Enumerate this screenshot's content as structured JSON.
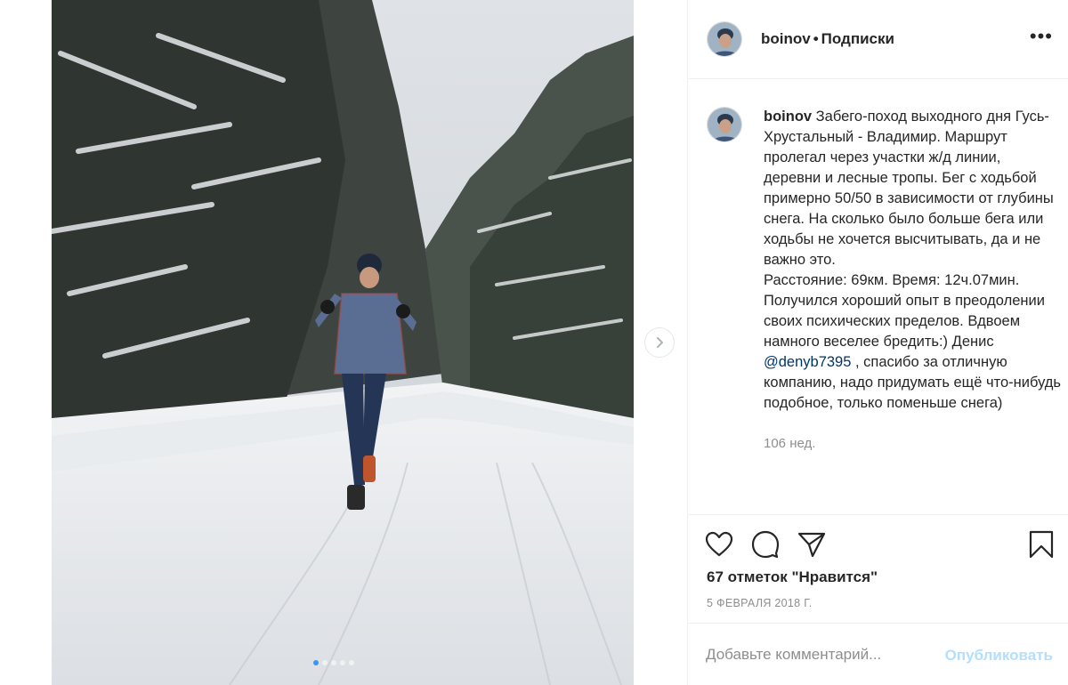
{
  "post": {
    "username": "boinov",
    "follow_status": "Подписки",
    "more_icon": "more-horizontal-icon",
    "photo_alt": "Бегун в клетчатой куртке на заснеженной лесной дороге",
    "carousel": {
      "total_slides": 5,
      "active_slide": 1
    }
  },
  "caption": {
    "username": "boinov",
    "text_part1": "Забего-поход выходного дня Гусь-Хрустальный - Владимир. Маршрут пролегал через участки ж/д линии, деревни и лесные тропы. Бег с ходьбой примерно 50/50 в зависимости от глубины снега. На сколько было больше бега или ходьбы не хочется высчитывать, да и не важно это.",
    "text_part2": "Расстояние: 69км. Время: 12ч.07мин.",
    "text_part3": "Получился хороший опыт в преодолении своих психических пределов. Вдвоем намного веселее бредить:) Денис ",
    "mention": "@denyb7395",
    "text_part4": " , спасибо за отличную компанию, надо придумать ещё что-нибудь подобное, только поменьше снега)",
    "time_ago": "106 нед."
  },
  "actions": {
    "icons": [
      "heart-icon",
      "comment-icon",
      "share-icon",
      "bookmark-icon"
    ],
    "likes": "67 отметок \"Нравится\"",
    "date": "5 ФЕВРАЛЯ 2018 Г."
  },
  "comment": {
    "placeholder": "Добавьте комментарий...",
    "publish_label": "Опубликовать"
  },
  "colors": {
    "link": "#003569",
    "secondary_text": "#8e8e8e",
    "publish_disabled": "#b2dffc",
    "carousel_active_dot": "#3a97f0"
  }
}
